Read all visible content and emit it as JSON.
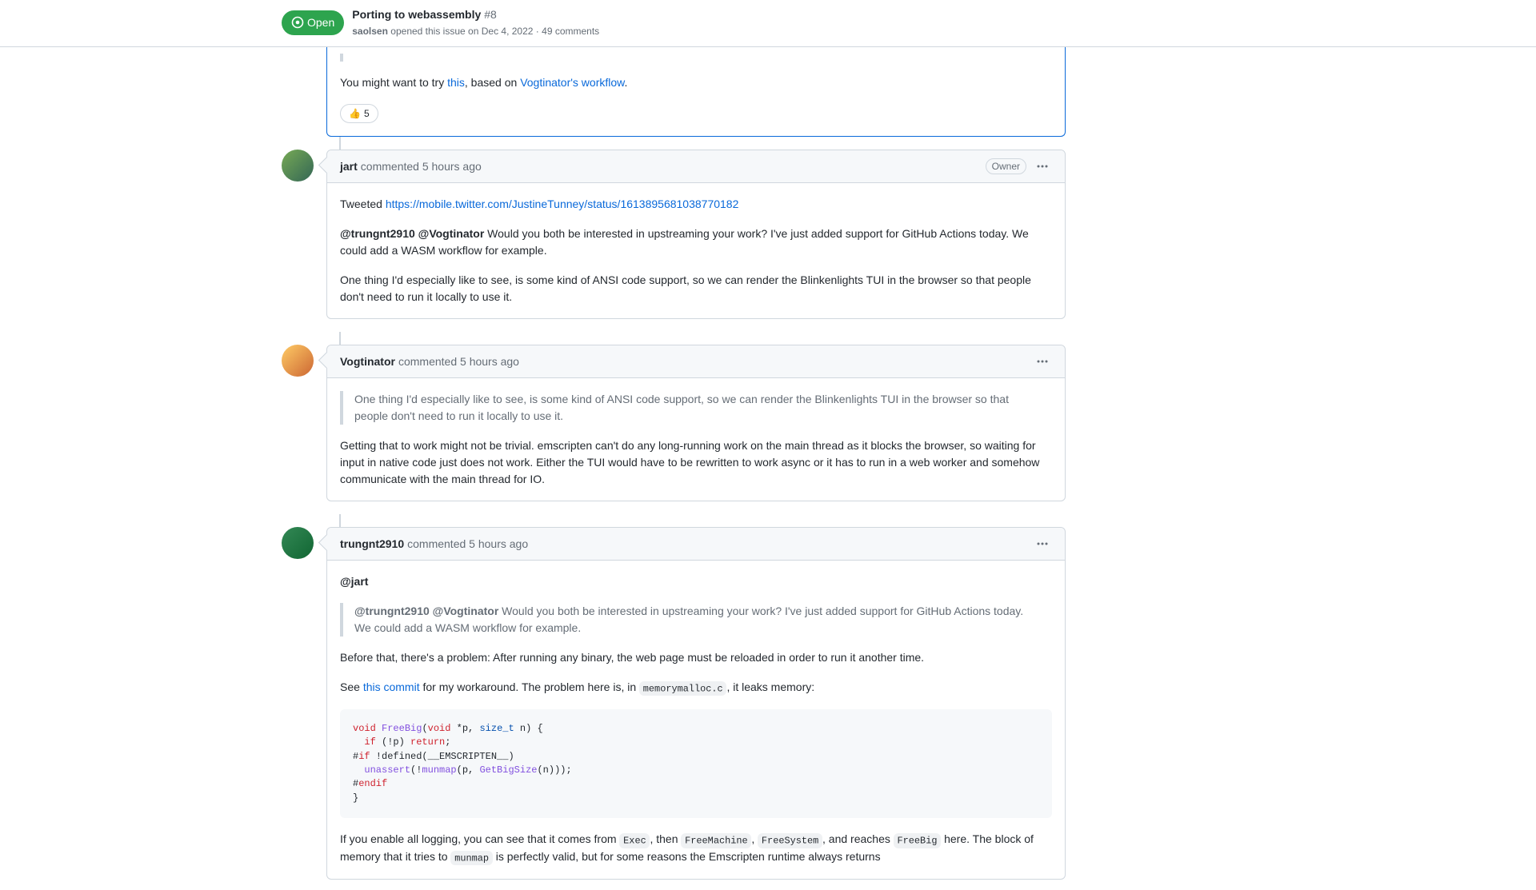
{
  "header": {
    "state": "Open",
    "title": "Porting to webassembly",
    "issue_number": "#8",
    "opened_by": "saolsen",
    "opened_text": "opened this issue",
    "opened_date": "on Dec 4, 2022",
    "separator": "·",
    "comments_count": "49 comments"
  },
  "truncated_comment0": {
    "text_prefix": "You might want to try ",
    "link1": "this",
    "text_mid": ", based on ",
    "link2": "Vogtinator's workflow",
    "text_end": ".",
    "reaction_emoji": "👍",
    "reaction_count": "5"
  },
  "comment1": {
    "author": "jart",
    "commented": "commented",
    "time": "5 hours ago",
    "badge": "Owner",
    "p1_prefix": "Tweeted ",
    "p1_link": "https://mobile.twitter.com/JustineTunney/status/1613895681038770182",
    "p2_m1": "@trungnt2910",
    "p2_m2": "@Vogtinator",
    "p2_text": " Would you both be interested in upstreaming your work? I've just added support for GitHub Actions today. We could add a WASM workflow for example.",
    "p3": "One thing I'd especially like to see, is some kind of ANSI code support, so we can render the Blinkenlights TUI in the browser so that people don't need to run it locally to use it."
  },
  "comment2": {
    "author": "Vogtinator",
    "commented": "commented",
    "time": "5 hours ago",
    "quote": "One thing I'd especially like to see, is some kind of ANSI code support, so we can render the Blinkenlights TUI in the browser so that people don't need to run it locally to use it.",
    "p1": "Getting that to work might not be trivial. emscripten can't do any long-running work on the main thread as it blocks the browser, so waiting for input in native code just does not work. Either the TUI would have to be rewritten to work async or it has to run in a web worker and somehow communicate with the main thread for IO."
  },
  "comment3": {
    "author": "trungnt2910",
    "commented": "commented",
    "time": "5 hours ago",
    "p_mention": "@jart",
    "quote_m1": "@trungnt2910",
    "quote_m2": "@Vogtinator",
    "quote_text": " Would you both be interested in upstreaming your work? I've just added support for GitHub Actions today. We could add a WASM workflow for example.",
    "p2": "Before that, there's a problem: After running any binary, the web page must be reloaded in order to run it another time.",
    "p3_pre": "See ",
    "p3_link": "this commit",
    "p3_mid": " for my workaround. The problem here is, in ",
    "p3_code": "memorymalloc.c",
    "p3_end": ", it leaks memory:",
    "code": {
      "l1_kw1": "void",
      "l1_fn": "FreeBig",
      "l1_kw2": "void",
      "l1_rest1": "(",
      "l1_rest2": " *p, ",
      "l1_tp": "size_t",
      "l1_rest3": " n) {",
      "l2_kw": "if",
      "l2_mid": " (!p) ",
      "l2_kw2": "return",
      "l2_end": ";",
      "l3_pre": "#",
      "l3_kw": "if",
      "l3_rest": " !defined(__EMSCRIPTEN__)",
      "l4_pre": "  ",
      "l4_fn1": "unassert",
      "l4_mid1": "(!",
      "l4_fn2": "munmap",
      "l4_mid2": "(p, ",
      "l4_fn3": "GetBigSize",
      "l4_end": "(n)));",
      "l5_pre": "#",
      "l5_kw": "endif",
      "l6": "}"
    },
    "p4_pre": "If you enable all logging, you can see that it comes from ",
    "p4_c1": "Exec",
    "p4_t1": ", then ",
    "p4_c2": "FreeMachine",
    "p4_t2": ", ",
    "p4_c3": "FreeSystem",
    "p4_t3": ", and reaches ",
    "p4_c4": "FreeBig",
    "p4_t4": " here. The block of memory that it tries to ",
    "p4_c5": "munmap",
    "p4_t5": " is perfectly valid, but for some reasons the Emscripten runtime always returns"
  }
}
